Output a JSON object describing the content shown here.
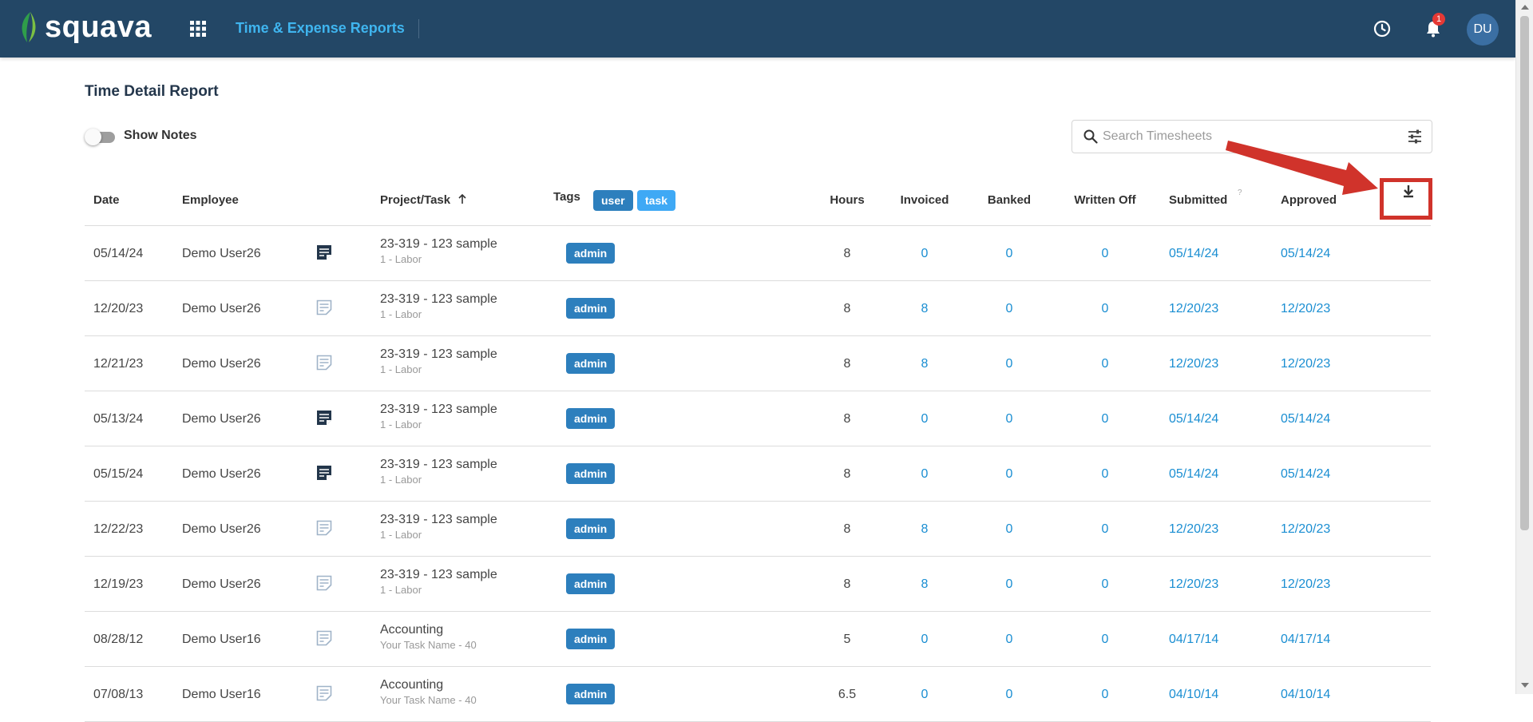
{
  "header": {
    "logo_text": "squava",
    "app_title": "Time & Expense Reports",
    "notification_count": "1",
    "avatar_initials": "DU",
    "colors": {
      "bar": "#234766",
      "accent": "#3fb5ef",
      "badge": "#e53935"
    }
  },
  "page": {
    "title": "Time Detail Report",
    "show_notes_label": "Show Notes",
    "show_notes_on": false,
    "search_placeholder": "Search Timesheets"
  },
  "table": {
    "columns": {
      "date": "Date",
      "employee": "Employee",
      "project_task": "Project/Task",
      "tags": "Tags",
      "hours": "Hours",
      "invoiced": "Invoiced",
      "banked": "Banked",
      "written_off": "Written Off",
      "submitted": "Submitted",
      "approved": "Approved"
    },
    "sort_column": "Project/Task",
    "sort_direction": "ascending",
    "header_tags": [
      "user",
      "task"
    ],
    "submitted_help": "?",
    "rows": [
      {
        "date": "05/14/24",
        "employee": "Demo User26",
        "has_note": true,
        "project": "23-319 - 123 sample",
        "task": "1 - Labor",
        "tag": "admin",
        "hours": "8",
        "invoiced": "0",
        "banked": "0",
        "written_off": "0",
        "submitted": "05/14/24",
        "approved": "05/14/24"
      },
      {
        "date": "12/20/23",
        "employee": "Demo User26",
        "has_note": false,
        "project": "23-319 - 123 sample",
        "task": "1 - Labor",
        "tag": "admin",
        "hours": "8",
        "invoiced": "8",
        "banked": "0",
        "written_off": "0",
        "submitted": "12/20/23",
        "approved": "12/20/23"
      },
      {
        "date": "12/21/23",
        "employee": "Demo User26",
        "has_note": false,
        "project": "23-319 - 123 sample",
        "task": "1 - Labor",
        "tag": "admin",
        "hours": "8",
        "invoiced": "8",
        "banked": "0",
        "written_off": "0",
        "submitted": "12/20/23",
        "approved": "12/20/23"
      },
      {
        "date": "05/13/24",
        "employee": "Demo User26",
        "has_note": true,
        "project": "23-319 - 123 sample",
        "task": "1 - Labor",
        "tag": "admin",
        "hours": "8",
        "invoiced": "0",
        "banked": "0",
        "written_off": "0",
        "submitted": "05/14/24",
        "approved": "05/14/24"
      },
      {
        "date": "05/15/24",
        "employee": "Demo User26",
        "has_note": true,
        "project": "23-319 - 123 sample",
        "task": "1 - Labor",
        "tag": "admin",
        "hours": "8",
        "invoiced": "0",
        "banked": "0",
        "written_off": "0",
        "submitted": "05/14/24",
        "approved": "05/14/24"
      },
      {
        "date": "12/22/23",
        "employee": "Demo User26",
        "has_note": false,
        "project": "23-319 - 123 sample",
        "task": "1 - Labor",
        "tag": "admin",
        "hours": "8",
        "invoiced": "8",
        "banked": "0",
        "written_off": "0",
        "submitted": "12/20/23",
        "approved": "12/20/23"
      },
      {
        "date": "12/19/23",
        "employee": "Demo User26",
        "has_note": false,
        "project": "23-319 - 123 sample",
        "task": "1 - Labor",
        "tag": "admin",
        "hours": "8",
        "invoiced": "8",
        "banked": "0",
        "written_off": "0",
        "submitted": "12/20/23",
        "approved": "12/20/23"
      },
      {
        "date": "08/28/12",
        "employee": "Demo User16",
        "has_note": false,
        "project": "Accounting",
        "task": "Your Task Name - 40",
        "tag": "admin",
        "hours": "5",
        "invoiced": "0",
        "banked": "0",
        "written_off": "0",
        "submitted": "04/17/14",
        "approved": "04/17/14"
      },
      {
        "date": "07/08/13",
        "employee": "Demo User16",
        "has_note": false,
        "project": "Accounting",
        "task": "Your Task Name - 40",
        "tag": "admin",
        "hours": "6.5",
        "invoiced": "0",
        "banked": "0",
        "written_off": "0",
        "submitted": "04/10/14",
        "approved": "04/10/14"
      }
    ]
  },
  "icons": {
    "apps": "grid-icon",
    "clock": "clock-icon",
    "bell": "bell-icon",
    "search": "search-icon",
    "filter": "sliders-icon",
    "download": "download-icon",
    "note_filled": "note-filled-icon",
    "note_outline": "note-outline-icon"
  },
  "annotation": {
    "color": "#d0332b"
  }
}
